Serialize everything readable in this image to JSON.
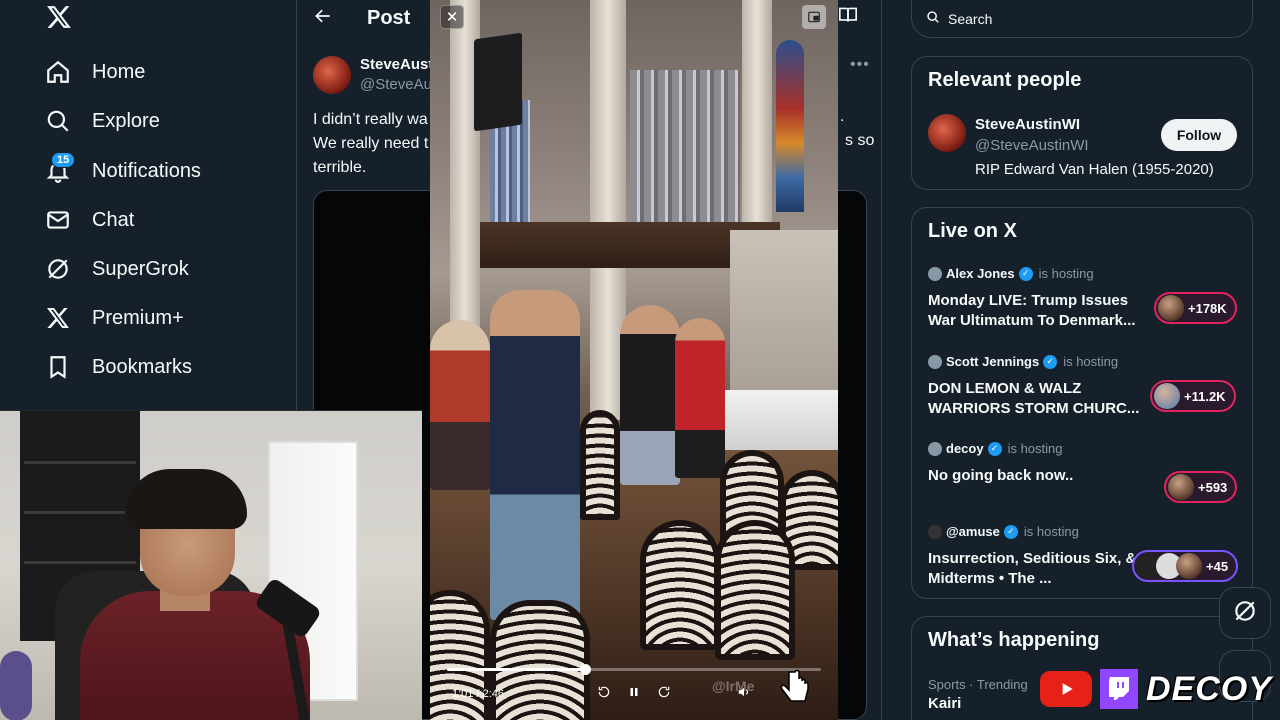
{
  "nav": {
    "items": [
      {
        "label": "Home",
        "icon": "home-icon"
      },
      {
        "label": "Explore",
        "icon": "search-icon"
      },
      {
        "label": "Notifications",
        "icon": "bell-icon",
        "badge": "15"
      },
      {
        "label": "Chat",
        "icon": "mail-icon"
      },
      {
        "label": "SuperGrok",
        "icon": "grok-icon"
      },
      {
        "label": "Premium+",
        "icon": "x-logo-icon"
      },
      {
        "label": "Bookmarks",
        "icon": "bookmark-icon"
      }
    ]
  },
  "post": {
    "header_title": "Post",
    "author_name": "SteveAust",
    "author_handle": "@SteveAus",
    "text_line1": "I didn’t really wa",
    "text_line2": "We really need t",
    "text_line3": "terrible.",
    "text_right1": ".",
    "text_right2": "s so"
  },
  "video": {
    "time": "1:01 / 2:46",
    "progress": 0.37,
    "watermark": "@IrMe"
  },
  "search": {
    "placeholder": "Search"
  },
  "relevant": {
    "title": "Relevant people",
    "name": "SteveAustinWI",
    "handle": "@SteveAustinWI",
    "bio": "RIP Edward Van Halen (1955-2020)",
    "follow_label": "Follow"
  },
  "live": {
    "title": "Live on X",
    "hosting_label": "is hosting",
    "items": [
      {
        "host": "Alex Jones",
        "title": "Monday LIVE: Trump Issues War Ultimatum To Denmark...",
        "count": "+178K",
        "pill_color": "#e0245e"
      },
      {
        "host": "Scott Jennings",
        "title": "DON LEMON & WALZ WARRIORS STORM CHURC...",
        "count": "+11.2K",
        "pill_color": "#e0245e"
      },
      {
        "host": "decoy",
        "title": "No going back now..",
        "count": "+593",
        "pill_color": "#e0245e"
      },
      {
        "host": "@amuse",
        "title": "Insurrection, Seditious Six, & Midterms • The ...",
        "count": "+45",
        "pill_color": "#7856ff"
      }
    ]
  },
  "happening": {
    "title": "What’s happening",
    "meta": "Sports · Trending",
    "name": "Kairi"
  },
  "brand": {
    "text": "DECOY"
  },
  "colors": {
    "accent": "#1d9bf0",
    "background": "#15202b",
    "border": "#38444d",
    "live_pink": "#e0245e",
    "live_purple": "#7856ff"
  }
}
